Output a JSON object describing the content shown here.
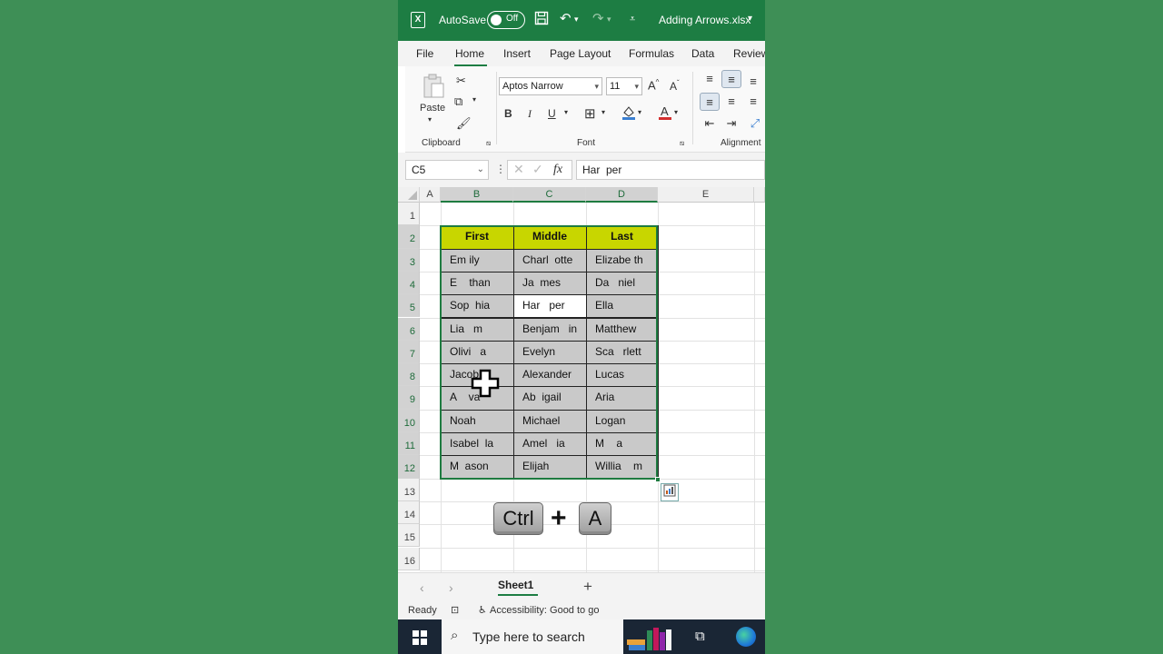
{
  "titlebar": {
    "autosave_label": "AutoSave",
    "autosave_state": "Off",
    "file_name": "Adding Arrows.xlsx",
    "app_icon": "excel-icon"
  },
  "ribbon_tabs": [
    "File",
    "Home",
    "Insert",
    "Page Layout",
    "Formulas",
    "Data",
    "Review"
  ],
  "active_tab": "Home",
  "ribbon": {
    "clipboard": {
      "paste_label": "Paste",
      "group_label": "Clipboard"
    },
    "font": {
      "font_name": "Aptos Narrow",
      "font_size": "11",
      "group_label": "Font",
      "bold": "B",
      "italic": "I",
      "underline": "U"
    },
    "alignment": {
      "group_label": "Alignment"
    }
  },
  "formula_bar": {
    "name_box": "C5",
    "fx_label": "fx",
    "formula": "Har  per"
  },
  "columns": [
    "A",
    "B",
    "C",
    "D",
    "E"
  ],
  "rows": [
    "1",
    "2",
    "3",
    "4",
    "5",
    "6",
    "7",
    "8",
    "9",
    "10",
    "11",
    "12",
    "13",
    "14",
    "15",
    "16"
  ],
  "table": {
    "headers": [
      "First",
      "Middle",
      "Last"
    ],
    "rows": [
      [
        "Em ily",
        "Charl  otte",
        "Elizabe th"
      ],
      [
        "E    than",
        "Ja  mes",
        "Da   niel"
      ],
      [
        "Sop  hia",
        "Har   per",
        "Ella"
      ],
      [
        "Lia   m",
        "Benjam   in",
        "Matthew"
      ],
      [
        "Olivi   a",
        "Evelyn",
        "Sca   rlett"
      ],
      [
        "Jacob",
        "Alexander",
        "Lucas"
      ],
      [
        "A    va",
        "Ab  igail",
        "Aria"
      ],
      [
        "Noah",
        "Michael",
        "Logan"
      ],
      [
        "Isabel  la",
        "Amel   ia",
        "M    a"
      ],
      [
        "M  ason",
        "Elijah",
        "Willia    m"
      ]
    ]
  },
  "shortcut": {
    "key1": "Ctrl",
    "plus": "+",
    "key2": "A"
  },
  "sheet_tabs": {
    "active": "Sheet1",
    "add": "+"
  },
  "status": {
    "ready": "Ready",
    "accessibility": "Accessibility: Good to go"
  },
  "taskbar": {
    "search_placeholder": "Type here to search"
  },
  "colors": {
    "excel_green": "#1d7d43",
    "header_fill": "#c8d600",
    "cell_fill": "#c9c9c9",
    "background": "#3e8f56"
  }
}
